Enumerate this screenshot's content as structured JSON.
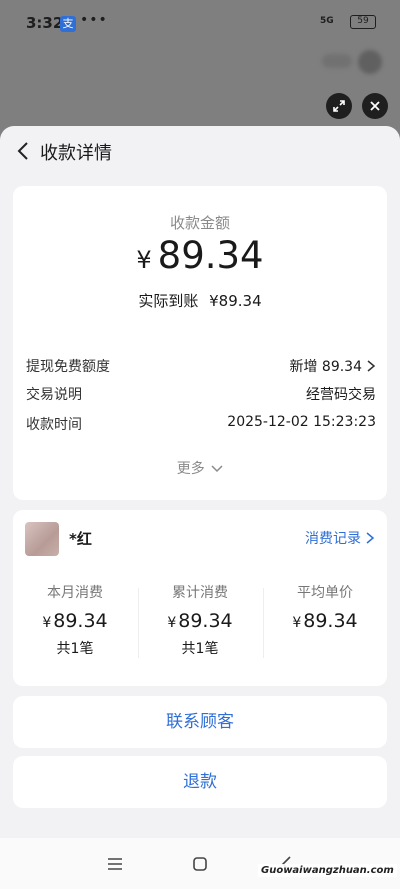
{
  "status_bar": {
    "time": "3:32",
    "app_badge": "支",
    "dots": "•••",
    "network": "5G",
    "battery": "59"
  },
  "header": {
    "title": "收款详情"
  },
  "payment": {
    "amount_label": "收款金额",
    "currency": "¥",
    "amount": "89.34",
    "received_label": "实际到账",
    "received_value": "¥89.34"
  },
  "details": [
    {
      "key": "提现免费额度",
      "value": "新增 89.34"
    },
    {
      "key": "交易说明",
      "value": "经营码交易"
    },
    {
      "key": "收款时间",
      "value": "2025-12-02 15:23:23"
    }
  ],
  "more_label": "更多",
  "customer": {
    "name": "*红",
    "records_label": "消费记录",
    "stats": [
      {
        "label": "本月消费",
        "currency": "¥",
        "value": "89.34",
        "count": "共1笔"
      },
      {
        "label": "累计消费",
        "currency": "¥",
        "value": "89.34",
        "count": "共1笔"
      },
      {
        "label": "平均单价",
        "currency": "¥",
        "value": "89.34",
        "count": ""
      }
    ]
  },
  "actions": {
    "contact": "联系顾客",
    "refund": "退款"
  },
  "watermark": "Guowaiwangzhuan.com",
  "colors": {
    "accent": "#2f6fd6",
    "sheet_bg": "#f2f2f4",
    "overlay": "#7f7f7f"
  }
}
